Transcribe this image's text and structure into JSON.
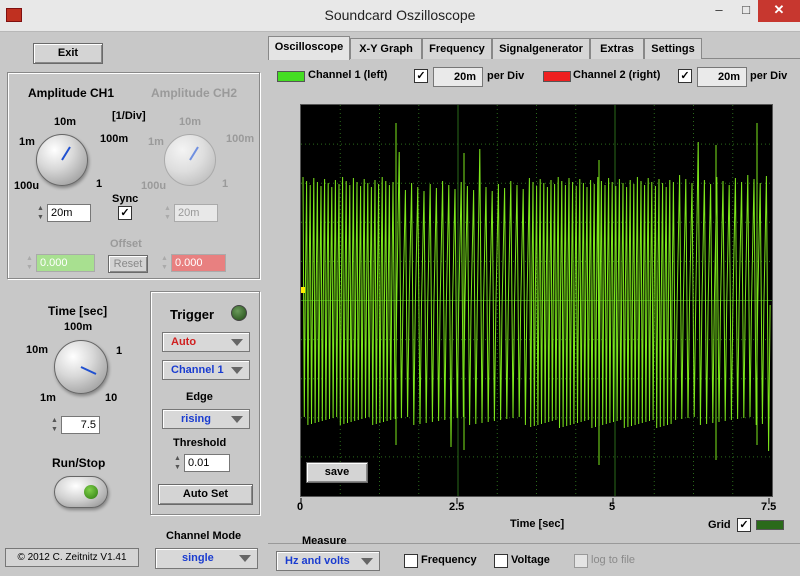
{
  "window": {
    "title": "Soundcard Oszilloscope",
    "minimize": "–",
    "maximize": "□",
    "close": "✕"
  },
  "left": {
    "exit_label": "Exit",
    "amp_ch1": {
      "title": "Amplitude CH1",
      "unit": "[1/Div]",
      "ticks": [
        "10m",
        "1m",
        "100m",
        "100u",
        "1"
      ],
      "value": "20m"
    },
    "amp_ch2": {
      "title": "Amplitude CH2",
      "ticks": [
        "10m",
        "1m",
        "100m",
        "100u",
        "1"
      ],
      "value": "20m"
    },
    "sync_label": "Sync",
    "sync_checked": true,
    "offset": {
      "label": "Offset",
      "ch1_value": "0.000",
      "reset_label": "Reset",
      "ch2_value": "0.000"
    },
    "time": {
      "title": "Time [sec]",
      "ticks": [
        "100m",
        "10m",
        "1",
        "1m",
        "10"
      ],
      "value": "7.5"
    },
    "runstop_label": "Run/Stop",
    "copyright": "© 2012  C. Zeitnitz V1.41",
    "trigger": {
      "title": "Trigger",
      "mode": "Auto",
      "channel": "Channel 1",
      "edge_label": "Edge",
      "edge": "rising",
      "threshold_label": "Threshold",
      "threshold_value": "0.01",
      "autoset_label": "Auto Set"
    },
    "channel_mode": {
      "label": "Channel Mode",
      "value": "single"
    }
  },
  "tabs": [
    "Oscilloscope",
    "X-Y Graph",
    "Frequency",
    "Signalgenerator",
    "Extras",
    "Settings"
  ],
  "active_tab": 0,
  "channels": {
    "ch1": {
      "label": "Channel 1 (left)",
      "color": "#44dd22",
      "enabled": true,
      "per_div_value": "20m",
      "per_div_label": "per Div"
    },
    "ch2": {
      "label": "Channel 2 (right)",
      "color": "#ee2020",
      "enabled": true,
      "per_div_value": "20m",
      "per_div_label": "per Div"
    }
  },
  "scope": {
    "save_label": "save",
    "x_ticks": [
      "0",
      "2.5",
      "5",
      "7.5"
    ],
    "xlabel": "Time [sec]",
    "grid_label": "Grid",
    "grid_checked": true,
    "grid_color": "#2a6a1a",
    "trace_color": "#7de81c",
    "background": "#000000"
  },
  "measure": {
    "label": "Measure",
    "mode": "Hz and volts",
    "frequency_label": "Frequency",
    "voltage_label": "Voltage",
    "log_label": "log to file"
  }
}
